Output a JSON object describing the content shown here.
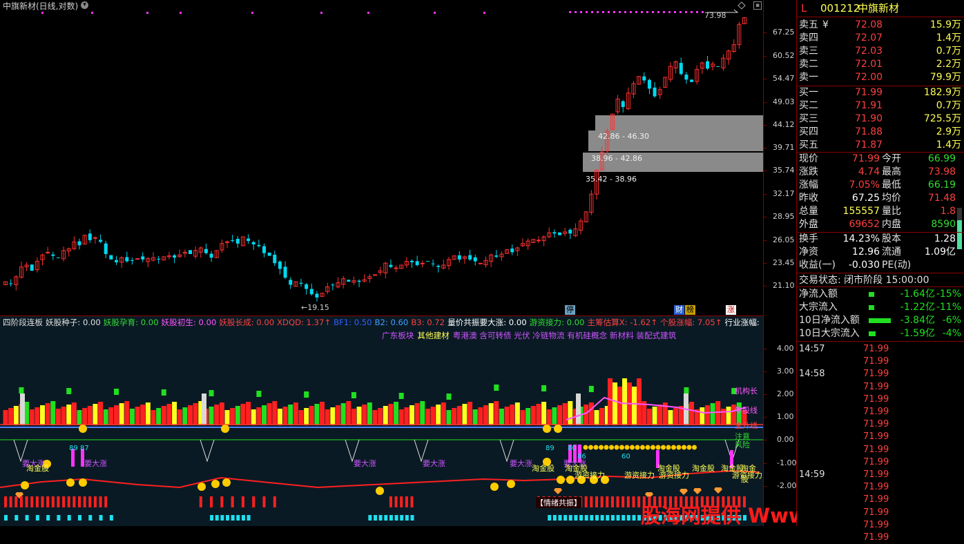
{
  "main": {
    "title": "中旗新材(日线,对数)",
    "price_labels": [
      "67.25",
      "60.52",
      "54.47",
      "49.03",
      "44.12",
      "39.71",
      "35.74",
      "32.17",
      "28.95",
      "26.05",
      "23.45",
      "21.10"
    ],
    "high_mark": "73.98",
    "low_mark": "19.15",
    "chip_zones": [
      "42.86 - 46.30",
      "38.96 - 42.86",
      "35.42 - 38.96"
    ],
    "badges": [
      "停",
      "财",
      "榜",
      "涨"
    ]
  },
  "indicator": {
    "title_parts": [
      {
        "text": "四阶段连板",
        "color": "#e0e0e0"
      },
      {
        "text": "妖股种子: 0.00",
        "color": "#e0e0e0"
      },
      {
        "text": "妖股孕育: 0.00",
        "color": "#33dd33"
      },
      {
        "text": "妖股初生: 0.00",
        "color": "#ff55ff"
      },
      {
        "text": "妖股长成: 0.00",
        "color": "#ff4040"
      },
      {
        "text": "XDQD: 1.37↑",
        "color": "#ff4040"
      },
      {
        "text": "BF1: 0.50",
        "color": "#3060ff"
      },
      {
        "text": "B2: 0.60",
        "color": "#40a0ff"
      },
      {
        "text": "B3: 0.72",
        "color": "#ff4040"
      },
      {
        "text": "量价共振要大涨: 0.00",
        "color": "#ffffff"
      },
      {
        "text": "游资接力: 0.00",
        "color": "#33dd33"
      },
      {
        "text": "主筹估算X: -1.62↑",
        "color": "#ff4040"
      },
      {
        "text": "个股涨幅: 7.05↑",
        "color": "#ff4040"
      },
      {
        "text": "行业涨幅:",
        "color": "#ffffff"
      }
    ],
    "sector_line": [
      {
        "text": "广东板块",
        "color": "#cc55ff"
      },
      {
        "text": "其他建材",
        "color": "#ffff55"
      },
      {
        "text": "粤港澳 含可转债 光伏 冷链物流 有机硅概念 新材料 装配式建筑",
        "color": "#cc55ff"
      }
    ],
    "axis_labels": [
      "4.00",
      "3.00",
      "2.00",
      "1.00",
      "0.00",
      "-1.00",
      "-2.00"
    ],
    "side_labels": [
      {
        "text": "机构长",
        "color": "#ff55ff"
      },
      {
        "text": "牛股线",
        "color": "#ff55ff"
      },
      {
        "text": "主升线",
        "color": "#ff4040"
      },
      {
        "text": "注意",
        "color": "#33dd33"
      },
      {
        "text": "风险",
        "color": "#33dd33"
      }
    ],
    "labels_yaodazhang": "要大涨",
    "label_taojin": "淘金股",
    "label_youzi": "游资接力",
    "label_qingxu": "【情绪共振】",
    "num_labels": [
      "89",
      "87",
      "89",
      "80",
      "86",
      "60"
    ]
  },
  "panel": {
    "code": "001212",
    "name": "中旗新材",
    "L": "L",
    "asks": [
      {
        "label": "卖五",
        "mark": "¥",
        "price": "72.08",
        "vol": "15.9万"
      },
      {
        "label": "卖四",
        "mark": "",
        "price": "72.07",
        "vol": "1.4万"
      },
      {
        "label": "卖三",
        "mark": "",
        "price": "72.03",
        "vol": "0.7万"
      },
      {
        "label": "卖二",
        "mark": "",
        "price": "72.01",
        "vol": "2.2万"
      },
      {
        "label": "卖一",
        "mark": "",
        "price": "72.00",
        "vol": "79.9万"
      }
    ],
    "bids": [
      {
        "label": "买一",
        "price": "71.99",
        "vol": "182.9万"
      },
      {
        "label": "买二",
        "price": "71.91",
        "vol": "0.7万"
      },
      {
        "label": "买三",
        "price": "71.90",
        "vol": "725.5万"
      },
      {
        "label": "买四",
        "price": "71.88",
        "vol": "2.9万"
      },
      {
        "label": "买五",
        "price": "71.87",
        "vol": "1.4万"
      }
    ],
    "stats": [
      {
        "l1": "现价",
        "v1": "71.99",
        "c1": "#ff4040",
        "l2": "今开",
        "v2": "66.99",
        "c2": "#33dd33"
      },
      {
        "l1": "涨跌",
        "v1": "4.74",
        "c1": "#ff4040",
        "l2": "最高",
        "v2": "73.98",
        "c2": "#ff4040"
      },
      {
        "l1": "涨幅",
        "v1": "7.05%",
        "c1": "#ff4040",
        "l2": "最低",
        "v2": "66.19",
        "c2": "#33dd33"
      },
      {
        "l1": "昨收",
        "v1": "67.25",
        "c1": "#ffffff",
        "l2": "均价",
        "v2": "71.48",
        "c2": "#ff4040"
      },
      {
        "l1": "总量",
        "v1": "155557",
        "c1": "#ffff55",
        "l2": "量比",
        "v2": "1.8",
        "c2": "#ff4040"
      },
      {
        "l1": "外盘",
        "v1": "69652",
        "c1": "#ff4040",
        "l2": "内盘",
        "v2": "8590",
        "c2": "#33dd33"
      },
      {
        "l1": "换手",
        "v1": "14.23%",
        "c1": "#ffffff",
        "l2": "股本",
        "v2": "1.28",
        "c2": "#ffffff"
      },
      {
        "l1": "净资",
        "v1": "12.96",
        "c1": "#ffffff",
        "l2": "流通",
        "v2": "1.09亿",
        "c2": "#ffffff"
      },
      {
        "l1": "收益(一)",
        "v1": "-0.030",
        "c1": "#ffffff",
        "l2": "PE(动)",
        "v2": "",
        "c2": "#ffffff"
      }
    ],
    "trade_status": "交易状态: 闭市阶段 15:00:00",
    "flows": [
      {
        "label": "净流入额",
        "val": "-1.64亿",
        "pct": "-15%"
      },
      {
        "label": "大宗流入",
        "val": "-1.22亿",
        "pct": "-11%"
      },
      {
        "label": "10日净流入额",
        "val": "-3.84亿",
        "pct": "-6%"
      },
      {
        "label": "10日大宗流入",
        "val": "-1.59亿",
        "pct": "-4%"
      }
    ],
    "ticks": [
      {
        "time": "14:57",
        "price": "71.99"
      },
      {
        "time": "",
        "price": "71.99"
      },
      {
        "time": "14:58",
        "price": "71.99"
      },
      {
        "time": "",
        "price": "71.99"
      },
      {
        "time": "",
        "price": "71.99"
      },
      {
        "time": "",
        "price": "71.99"
      },
      {
        "time": "",
        "price": "71.99"
      },
      {
        "time": "",
        "price": "71.99"
      },
      {
        "time": "",
        "price": "71.99"
      },
      {
        "time": "",
        "price": "71.99"
      },
      {
        "time": "14:59",
        "price": "71.99"
      },
      {
        "time": "",
        "price": "71.99"
      },
      {
        "time": "",
        "price": "71.99"
      },
      {
        "time": "",
        "price": "71.99"
      },
      {
        "time": "",
        "price": "71.99"
      },
      {
        "time": "",
        "price": "71.99"
      }
    ]
  },
  "watermark": "股海网提供 Www.Guhai.Com.CN",
  "colors": {
    "up": "#ff3030",
    "down": "#00d8f0",
    "frame": "#8b0000",
    "green": "#33dd33",
    "yellow": "#ffff33"
  }
}
